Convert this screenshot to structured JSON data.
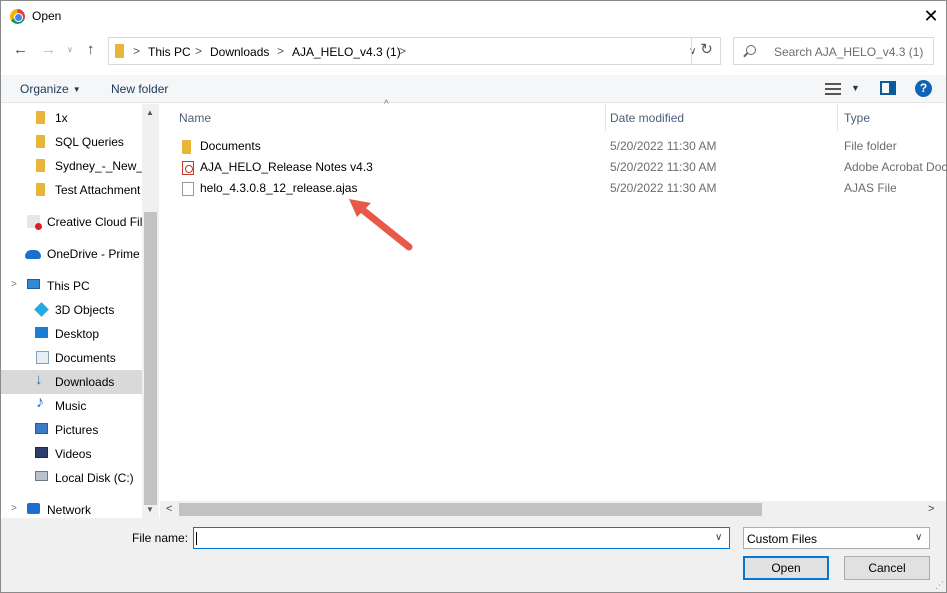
{
  "window": {
    "title": "Open",
    "close_glyph": "✕"
  },
  "address": {
    "crumbs": [
      "This PC",
      "Downloads",
      "AJA_HELO_v4.3 (1)"
    ],
    "separator": ">",
    "refresh_glyph": "↻"
  },
  "search": {
    "placeholder": "Search AJA_HELO_v4.3 (1)"
  },
  "toolbar": {
    "organize_label": "Organize",
    "new_folder_label": "New folder",
    "help_label": "?"
  },
  "nav": {
    "items": [
      {
        "label": "1x",
        "icon": "folder-icon"
      },
      {
        "label": "SQL Queries",
        "icon": "folder-icon"
      },
      {
        "label": "Sydney_-_New_E",
        "icon": "folder-icon"
      },
      {
        "label": "Test Attachment",
        "icon": "folder-icon"
      },
      {
        "label": "Creative Cloud Fil",
        "icon": "creative-cloud-icon"
      },
      {
        "label": "OneDrive - Prime",
        "icon": "onedrive-icon"
      },
      {
        "label": "This PC",
        "icon": "computer-icon"
      },
      {
        "label": "3D Objects",
        "icon": "3d-objects-icon"
      },
      {
        "label": "Desktop",
        "icon": "desktop-icon"
      },
      {
        "label": "Documents",
        "icon": "documents-icon"
      },
      {
        "label": "Downloads",
        "icon": "downloads-icon",
        "selected": true
      },
      {
        "label": "Music",
        "icon": "music-icon"
      },
      {
        "label": "Pictures",
        "icon": "pictures-icon"
      },
      {
        "label": "Videos",
        "icon": "videos-icon"
      },
      {
        "label": "Local Disk (C:)",
        "icon": "local-disk-icon"
      },
      {
        "label": "Network",
        "icon": "network-icon"
      }
    ]
  },
  "files": {
    "columns": [
      "Name",
      "Date modified",
      "Type"
    ],
    "rows": [
      {
        "name": "Documents",
        "date": "5/20/2022 11:30 AM",
        "type": "File folder",
        "icon": "folder-icon"
      },
      {
        "name": "AJA_HELO_Release Notes v4.3",
        "date": "5/20/2022 11:30 AM",
        "type": "Adobe Acrobat Doc",
        "icon": "pdf-icon"
      },
      {
        "name": "helo_4.3.0.8_12_release.ajas",
        "date": "5/20/2022 11:30 AM",
        "type": "AJAS File",
        "icon": "file-icon"
      }
    ]
  },
  "bottom": {
    "file_name_label": "File name:",
    "file_name_value": "",
    "file_type_value": "Custom Files",
    "open_label": "Open",
    "cancel_label": "Cancel"
  },
  "colors": {
    "accent": "#0078d7",
    "annotation_arrow": "#e8594a",
    "selected_bg": "#d9d9d9"
  }
}
